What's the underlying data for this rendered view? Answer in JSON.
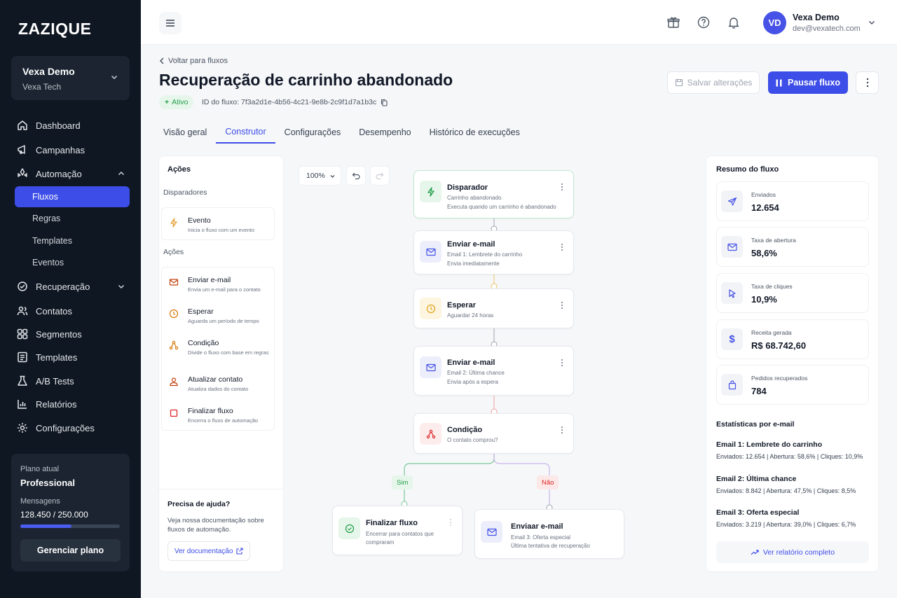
{
  "brand": {
    "logo": "ZAZIQUE",
    "accent": "#3d4de8"
  },
  "org": {
    "name": "Vexa Demo",
    "company": "Vexa Tech"
  },
  "nav": [
    {
      "label": "Dashboard",
      "icon": "home-icon"
    },
    {
      "label": "Campanhas",
      "icon": "megaphone-icon"
    },
    {
      "label": "Automação",
      "icon": "automation-icon"
    },
    {
      "label": "Recuperação",
      "icon": "recovery-icon"
    },
    {
      "label": "Contatos",
      "icon": "contacts-icon"
    },
    {
      "label": "Segmentos",
      "icon": "segments-icon"
    },
    {
      "label": "Templates",
      "icon": "templates-icon"
    },
    {
      "label": "A/B Tests",
      "icon": "ab-tests-icon"
    },
    {
      "label": "Relatórios",
      "icon": "reports-icon"
    },
    {
      "label": "Configurações",
      "icon": "gear-icon"
    }
  ],
  "automation_sub": [
    "Fluxos",
    "Regras",
    "Templates",
    "Eventos"
  ],
  "plan": {
    "label": "Plano atual",
    "name": "Professional",
    "messages_label": "Mensagens",
    "messages": "128.450 / 250.000",
    "usage_fraction": 0.5138,
    "button": "Gerenciar plano"
  },
  "user": {
    "initials": "VD",
    "name": "Vexa Demo",
    "email": "dev@vexatech.com"
  },
  "header": {
    "back": "Voltar para fluxos",
    "title": "Recuperação de carrinho abandonado",
    "status": "Ativo",
    "flow_id": "ID do fluxo: 7f3a2d1e-4b56-4c21-9e8b-2c9f1d7a1b3c",
    "save": "Salvar alterações",
    "pause": "Pausar fluxo"
  },
  "tabs": [
    "Visão geral",
    "Construtor",
    "Configurações",
    "Desempenho",
    "Histórico de execuções"
  ],
  "active_tab": "Construtor",
  "actions_panel": {
    "title": "Ações",
    "triggers_label": "Disparadores",
    "trigger": {
      "title": "Evento",
      "desc": "Inicia o fluxo com um evento"
    },
    "actions_label": "Ações",
    "actions": [
      {
        "title": "Enviar e-mail",
        "desc": "Envia um e-mail para o contato"
      },
      {
        "title": "Esperar",
        "desc": "Aguarda um período de tempo"
      },
      {
        "title": "Condição",
        "desc": "Divide o fluxo com base em regras"
      },
      {
        "title": "Atualizar contato",
        "desc": "Atualiza dados do contato"
      },
      {
        "title": "Finalizar fluxo",
        "desc": "Encerra o fluxo de automação"
      }
    ],
    "help": {
      "title": "Precisa de ajuda?",
      "text": "Veja nossa documentação sobre fluxos de automação.",
      "button": "Ver documentação"
    }
  },
  "canvas": {
    "zoom": "100%",
    "nodes": [
      {
        "title": "Disparador",
        "line1": "Carrinho abandonado",
        "line2": "Executa quando um carrinho é abandonado"
      },
      {
        "title": "Enviar e-mail",
        "line1": "Email 1: Lembrete do carrinho",
        "line2": "Envia imediatamente"
      },
      {
        "title": "Esperar",
        "line1": "Aguardar 24 horas",
        "line2": ""
      },
      {
        "title": "Enviar e-mail",
        "line1": "Email 2: Última chance",
        "line2": "Envia após a espera"
      },
      {
        "title": "Condição",
        "line1": "O contato comprou?",
        "line2": ""
      },
      {
        "title": "Finalizar fluxo",
        "line1": "Encerrar para contatos que",
        "line2": "compraram"
      },
      {
        "title": "Enviaar e-mail",
        "line1": "Email 3: Oferta especial",
        "line2": "Última tentativa de recuperação"
      }
    ],
    "branch_yes": "Sim",
    "branch_no": "Não"
  },
  "summary": {
    "title": "Resumo do fluxo",
    "stats": [
      {
        "label": "Enviados",
        "value": "12.654",
        "icon": "send-icon"
      },
      {
        "label": "Taxa de abertura",
        "value": "58,6%",
        "icon": "mail-icon"
      },
      {
        "label": "Taxa de cliques",
        "value": "10,9%",
        "icon": "cursor-icon"
      },
      {
        "label": "Receita gerada",
        "value": "R$ 68.742,60",
        "icon": "dollar-icon"
      },
      {
        "label": "Pedidos recuperados",
        "value": "784",
        "icon": "bag-icon"
      }
    ],
    "email_stats_title": "Estatísticas por e-mail",
    "emails": [
      {
        "title": "Email 1: Lembrete do carrinho",
        "detail": "Enviados: 12.654 | Abertura: 58,6% | Cliques: 10,9%"
      },
      {
        "title": "Email 2: Última chance",
        "detail": "Enviados: 8.842 | Abertura: 47,5% | Cliques: 8,5%"
      },
      {
        "title": "Email 3: Oferta especial",
        "detail": "Enviados: 3.219 | Abertura: 39,0% | Cliques: 6,7%"
      }
    ],
    "report_button": "Ver relatório completo"
  }
}
